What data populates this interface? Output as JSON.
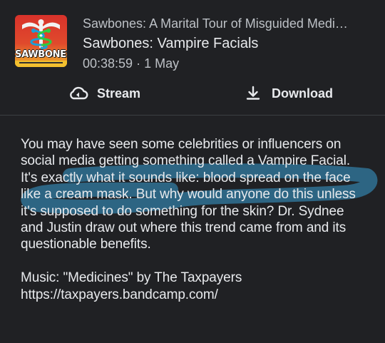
{
  "podcast": {
    "name": "Sawbones: A Marital Tour of Misguided Medi…",
    "art_text": "SAWBONES"
  },
  "episode": {
    "title": "Sawbones: Vampire Facials",
    "duration": "00:38:59",
    "separator": "·",
    "date": "1 May"
  },
  "actions": {
    "stream_label": "Stream",
    "download_label": "Download"
  },
  "description": {
    "text_before": "You may have seen some celebrities or influencers on social media getting something called a Vampire Facial. ",
    "highlighted": "It's exactly what it sounds like: blood spread on the face like a cream mask.",
    "text_after": " But why would anyone do this unless it's supposed to do something for the skin? Dr. Sydnee and Justin draw out where this trend came from and its questionable benefits.",
    "music_credit": "Music: \"Medicines\" by The Taxpayers",
    "music_url": "https://taxpayers.bandcamp.com/"
  },
  "colors": {
    "background": "#202124",
    "highlight": "#2f6d8e",
    "art_red": "#d8322b",
    "art_yellow": "#f0b42a"
  },
  "icons": {
    "stream": "cloud-stream-icon",
    "download": "download-icon"
  }
}
